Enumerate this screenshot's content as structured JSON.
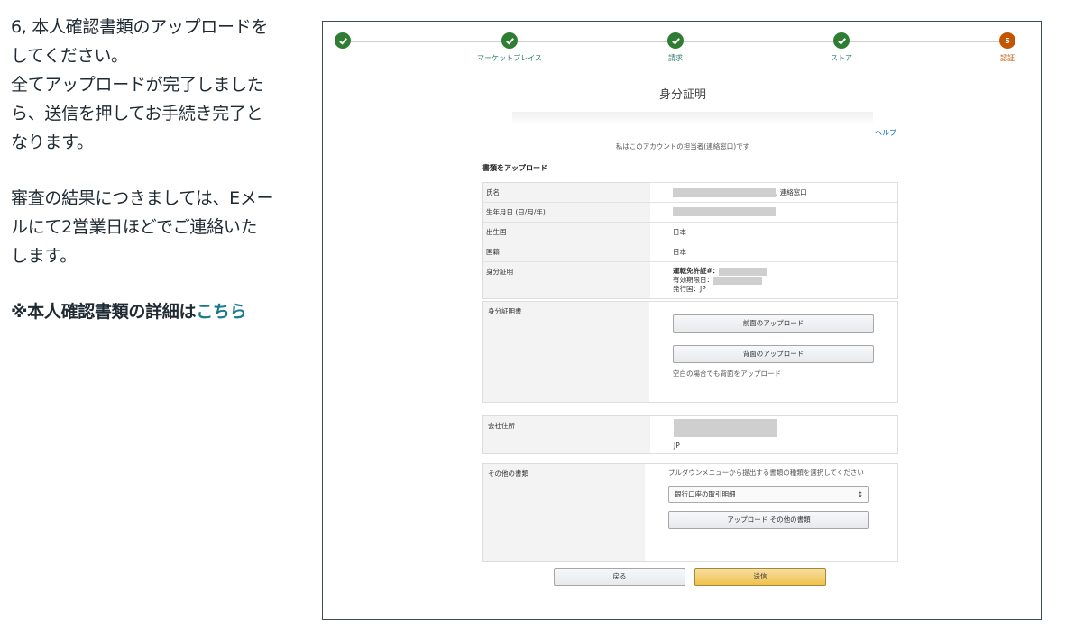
{
  "instructions": {
    "line1": "6, 本人確認書類のアップロードを",
    "line2": "してください。",
    "line3": "全てアップロードが完了しました",
    "line4": "ら、送信を押してお手続き完了と",
    "line5": "なります。",
    "line6": "審査の結果につきましては、Eメー",
    "line7": "ルにて2営業日ほどでご連絡いた",
    "line8": "します。",
    "note_prefix": "※本人確認書類の詳細は",
    "note_link": "こちら"
  },
  "stepper": {
    "steps": [
      {
        "label": "",
        "state": "done"
      },
      {
        "label": "マーケットプレイス",
        "state": "done"
      },
      {
        "label": "請求",
        "state": "done"
      },
      {
        "label": "ストア",
        "state": "done"
      },
      {
        "label": "認証",
        "state": "current",
        "number": "5"
      }
    ]
  },
  "form": {
    "title": "身分証明",
    "help": "ヘルプ",
    "contact_note": "私はこのアカウントの担当者(連絡窓口)です",
    "section_heading": "書類をアップロード",
    "info": {
      "name_label": "氏名",
      "name_suffix": ", 連絡窓口",
      "dob_label": "生年月日 (日/月/年)",
      "birth_country_label": "出生国",
      "birth_country_value": "日本",
      "nationality_label": "国籍",
      "nationality_value": "日本",
      "id_label": "身分証明",
      "id_license_label": "運転免許証#：",
      "id_expiry_label": "有効期限日：",
      "id_issuer": "発行国：JP"
    },
    "id_doc": {
      "label": "身分証明書",
      "front_button": "前面のアップロード",
      "back_button": "背面のアップロード",
      "hint": "空白の場合でも背面をアップロード"
    },
    "address": {
      "label": "会社住所",
      "country": "JP"
    },
    "other_docs": {
      "label": "その他の書類",
      "hint": "プルダウンメニューから提出する書類の種類を選択してください",
      "selected": "銀行口座の取引明細",
      "upload_button": "アップロード その他の書類"
    },
    "back_button": "戻る",
    "submit_button": "送信"
  },
  "colors": {
    "step_done": "#2f7d32",
    "step_current": "#c45500",
    "link": "#1a7a8c",
    "submit": "#f0c14b"
  }
}
